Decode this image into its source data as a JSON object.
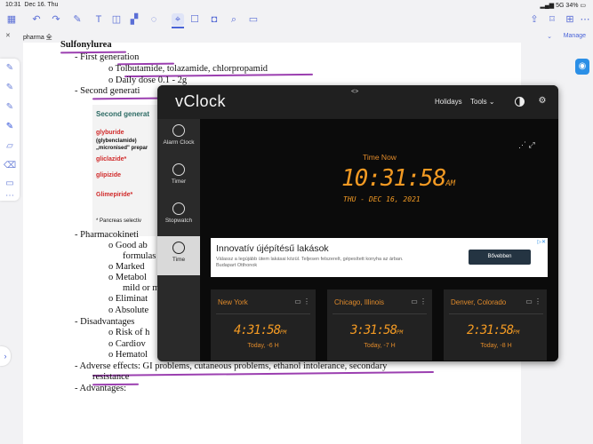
{
  "status_bar": {
    "time": "10:31",
    "date": "Dec 16. Thu",
    "network": "5G",
    "battery": "34%"
  },
  "toolbar": {
    "icons": [
      "sidebar-icon",
      "undo-icon",
      "redo-icon",
      "pen-icon",
      "text-icon",
      "shape-icon",
      "lasso-icon",
      "eraser-icon",
      "cursor-icon",
      "hand-icon",
      "camera-icon",
      "mic-icon",
      "scan-icon"
    ]
  },
  "file_bar": {
    "filename": "pharma 全",
    "manage": "Manage"
  },
  "note": {
    "title": "Sulfonylurea",
    "lines": [
      "-      First generation",
      "o      Tolbutamide, tolazamide, chlorpropamid",
      "o      Daily dose 0.1 - 2g",
      "-      Second generati",
      "-      Pharmacokineti",
      "o      Good ab",
      "formulas",
      "o      Marked",
      "o      Metabol",
      "mild or m",
      "o      Eliminat",
      "o      Absolute",
      "-      Disadvantages",
      "o      Risk of h",
      "o      Cardiov",
      "o      Hematol",
      "-      Adverse effects: GI problems, cutaneous problems, ethanol intolerance, secondary",
      "resistance",
      "-      Advantages:"
    ],
    "table": {
      "heading": "Second generat",
      "row1": "glyburide",
      "row1b": "(glybenclamide)",
      "row1c": "„micronised\" prepar",
      "row2": "gliclazide*",
      "row3": "glipizide",
      "row4": "Glimepiride*",
      "footnote": "* Pancreas selectiv"
    }
  },
  "vclock": {
    "logo": "vClock",
    "drag_handle": "<>",
    "nav": {
      "holidays": "Holidays",
      "tools": "Tools"
    },
    "sidebar": [
      {
        "label": "Alarm Clock",
        "active": false
      },
      {
        "label": "Timer",
        "active": false
      },
      {
        "label": "Stopwatch",
        "active": false
      },
      {
        "label": "Time",
        "active": true
      }
    ],
    "time_now_label": "Time Now",
    "time": "10:31:58",
    "ampm": "AM",
    "date": "THU - DEC 16, 2021",
    "accent_color": "#f39a23",
    "ad": {
      "title": "Innovatív újépítésű lakások",
      "sub": "Válassz a legújább ütem lakásai közül. Teljesen felszerelt, gépesített konyha az árban.",
      "brand": "Budapart Otthonok",
      "button": "Bővebben",
      "adchoice": "▷✕"
    },
    "cities": [
      {
        "name": "New York",
        "time": "4:31:58",
        "ampm": "PM",
        "diff": "Today, -6 H"
      },
      {
        "name": "Chicago, Illinois",
        "time": "3:31:58",
        "ampm": "PM",
        "diff": "Today, -7 H"
      },
      {
        "name": "Denver, Colorado",
        "time": "2:31:58",
        "ampm": "PM",
        "diff": "Today, -8 H"
      }
    ]
  }
}
